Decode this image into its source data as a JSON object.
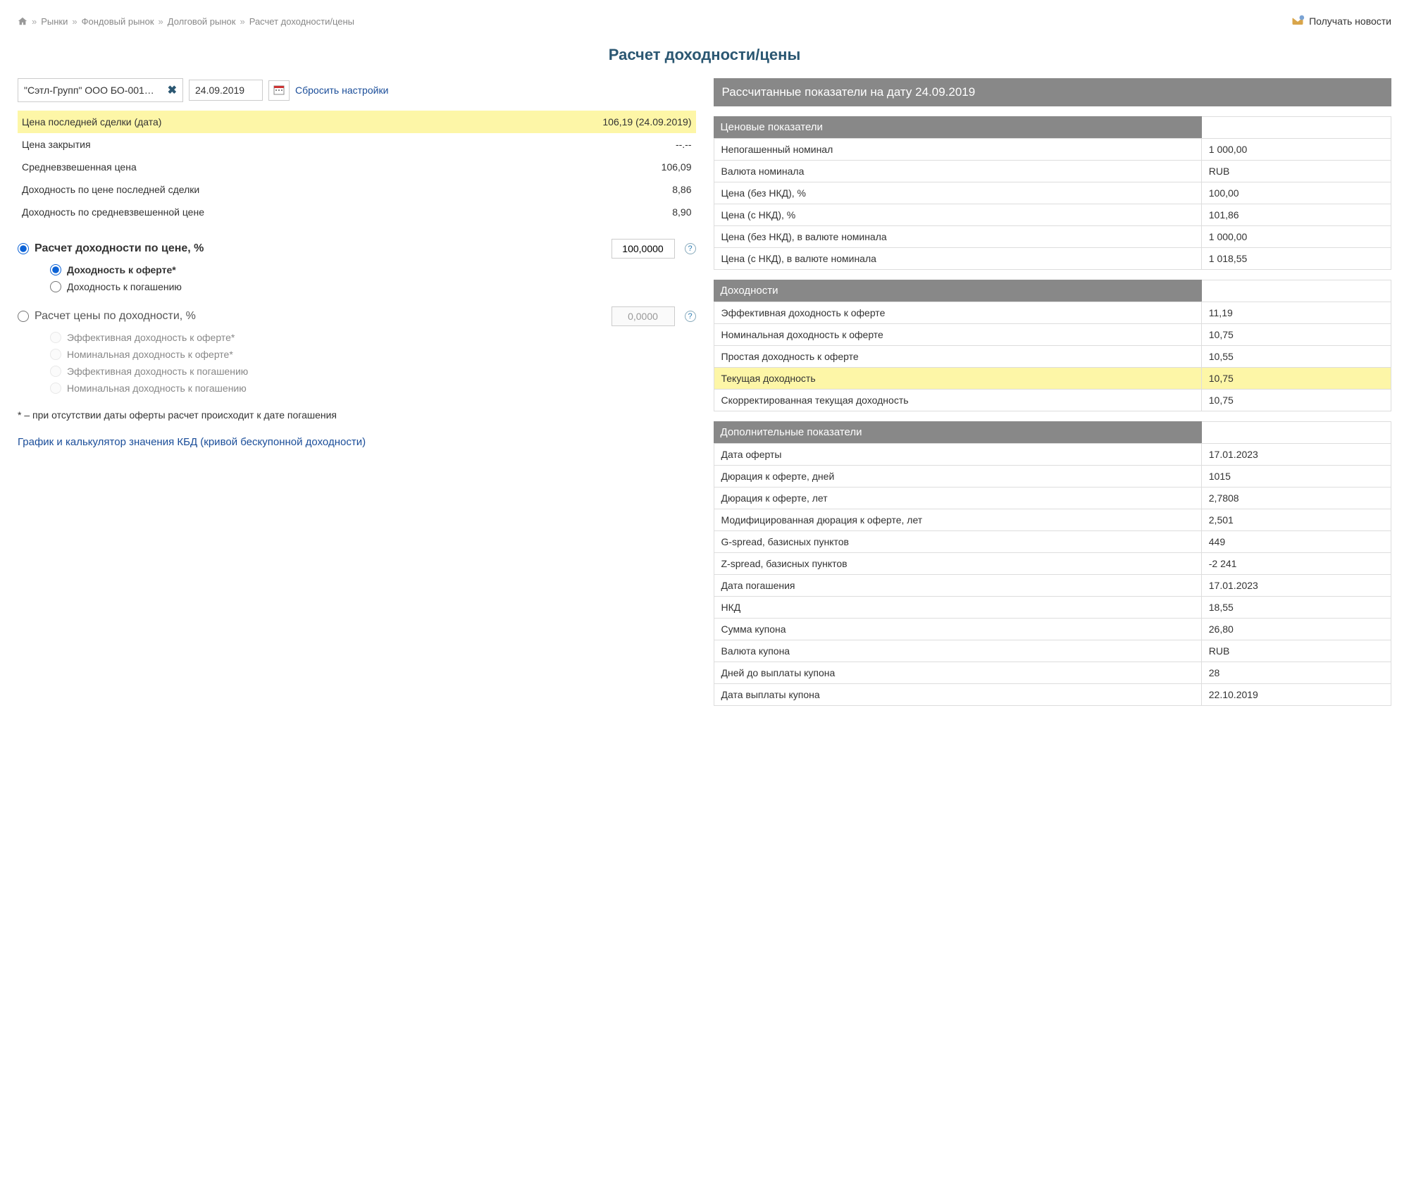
{
  "breadcrumb": {
    "items": [
      "Рынки",
      "Фондовый рынок",
      "Долговой рынок",
      "Расчет доходности/цены"
    ]
  },
  "news_link": "Получать новости",
  "page_title": "Расчет доходности/цены",
  "instrument": "\"Сэтл-Групп\" ООО БО-001…",
  "date": "24.09.2019",
  "reset": "Сбросить настройки",
  "left_info": [
    {
      "label": "Цена последней сделки (дата)",
      "value": "106,19 (24.09.2019)",
      "hl": true
    },
    {
      "label": "Цена закрытия",
      "value": "--.--"
    },
    {
      "label": "Средневзвешенная цена",
      "value": "106,09"
    },
    {
      "label": "Доходность по цене последней сделки",
      "value": "8,86"
    },
    {
      "label": "Доходность по средневзвешенной цене",
      "value": "8,90"
    }
  ],
  "calc": {
    "by_price_label": "Расчет доходности по цене, %",
    "price_value": "100,0000",
    "opt_offer": "Доходность к оферте*",
    "opt_redeem": "Доходность к погашению",
    "by_yield_label": "Расчет цены по доходности, %",
    "yield_value": "0,0000",
    "y_eff_offer": "Эффективная доходность к оферте*",
    "y_nom_offer": "Номинальная доходность к оферте*",
    "y_eff_redeem": "Эффективная доходность к погашению",
    "y_nom_redeem": "Номинальная доходность к погашению"
  },
  "footnote": "* – при отсутствии даты оферты расчет происходит к дате погашения",
  "kbd_link": "График и калькулятор значения КБД (кривой бескупонной доходности)",
  "right_header": "Рассчитанные показатели на дату 24.09.2019",
  "price_section": {
    "title": "Ценовые показатели",
    "rows": [
      {
        "label": "Непогашенный номинал",
        "value": "1 000,00"
      },
      {
        "label": "Валюта номинала",
        "value": "RUB"
      },
      {
        "label": "Цена (без НКД), %",
        "value": "100,00"
      },
      {
        "label": "Цена (с НКД), %",
        "value": "101,86"
      },
      {
        "label": "Цена (без НКД), в валюте номинала",
        "value": "1 000,00"
      },
      {
        "label": "Цена (с НКД), в валюте номинала",
        "value": "1 018,55"
      }
    ]
  },
  "yield_section": {
    "title": "Доходности",
    "rows": [
      {
        "label": "Эффективная доходность к оферте",
        "value": "11,19"
      },
      {
        "label": "Номинальная доходность к оферте",
        "value": "10,75"
      },
      {
        "label": "Простая доходность к оферте",
        "value": "10,55"
      },
      {
        "label": "Текущая доходность",
        "value": "10,75",
        "hl": true
      },
      {
        "label": "Скорректированная текущая доходность",
        "value": "10,75"
      }
    ]
  },
  "extra_section": {
    "title": "Дополнительные показатели",
    "rows": [
      {
        "label": "Дата оферты",
        "value": "17.01.2023"
      },
      {
        "label": "Дюрация к оферте, дней",
        "value": "1015"
      },
      {
        "label": "Дюрация к оферте, лет",
        "value": "2,7808"
      },
      {
        "label": "Модифицированная дюрация к оферте, лет",
        "value": "2,501"
      },
      {
        "label": "G-spread, базисных пунктов",
        "value": "449"
      },
      {
        "label": "Z-spread, базисных пунктов",
        "value": "-2 241"
      },
      {
        "label": "Дата погашения",
        "value": "17.01.2023"
      },
      {
        "label": "НКД",
        "value": "18,55"
      },
      {
        "label": "Сумма купона",
        "value": "26,80"
      },
      {
        "label": "Валюта купона",
        "value": "RUB"
      },
      {
        "label": "Дней до выплаты купона",
        "value": "28"
      },
      {
        "label": "Дата выплаты купона",
        "value": "22.10.2019"
      }
    ]
  }
}
